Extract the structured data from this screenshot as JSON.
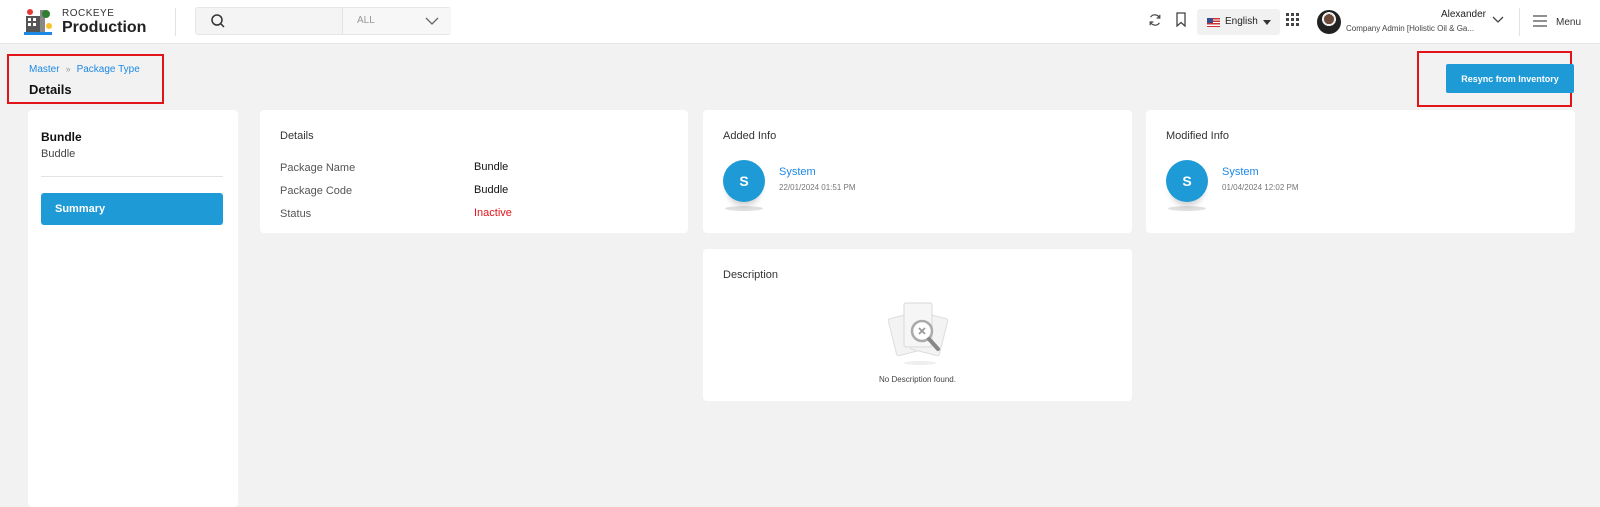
{
  "header": {
    "brand_top": "ROCKEYE",
    "brand_main": "Production",
    "search_placeholder": "",
    "search_scope": "ALL",
    "language": "English",
    "user_name": "Alexander",
    "user_role": "Company Admin [Holistic Oil & Ga...",
    "menu_label": "Menu"
  },
  "breadcrumb": {
    "items": [
      "Master",
      "Package Type"
    ],
    "page_title": "Details"
  },
  "actions": {
    "resync_label": "Resync from Inventory"
  },
  "left_panel": {
    "name": "Bundle",
    "code": "Buddle",
    "summary_label": "Summary"
  },
  "details": {
    "title": "Details",
    "rows": [
      {
        "label": "Package Name",
        "value": "Bundle"
      },
      {
        "label": "Package Code",
        "value": "Buddle"
      },
      {
        "label": "Status",
        "value": "Inactive"
      }
    ]
  },
  "added_info": {
    "title": "Added Info",
    "initial": "S",
    "name": "System",
    "date": "22/01/2024 01:51 PM"
  },
  "modified_info": {
    "title": "Modified Info",
    "initial": "S",
    "name": "System",
    "date": "01/04/2024 12:02 PM"
  },
  "description": {
    "title": "Description",
    "empty_text": "No Description found."
  },
  "colors": {
    "accent": "#1e9ad6",
    "link": "#1e88e5",
    "status_inactive": "#e1141a",
    "highlight_box": "#e1141a"
  },
  "icons": [
    "logo-icon",
    "search-icon",
    "chevron-down-icon",
    "refresh-icon",
    "bookmark-icon",
    "flag-us-icon",
    "grid-apps-icon",
    "hamburger-menu-icon",
    "no-description-icon"
  ]
}
